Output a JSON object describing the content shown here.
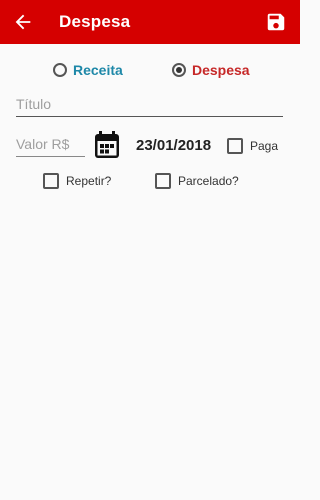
{
  "appbar": {
    "title": "Despesa",
    "back_icon": "arrow-left-icon",
    "save_icon": "floppy-disk-icon",
    "color": "#d50000"
  },
  "type_radio": {
    "options": [
      {
        "label": "Receita",
        "selected": false,
        "color": "#1e88a8"
      },
      {
        "label": "Despesa",
        "selected": true,
        "color": "#c62828"
      }
    ]
  },
  "form": {
    "titulo": {
      "placeholder": "Título",
      "value": ""
    },
    "valor": {
      "placeholder": "Valor R$",
      "value": ""
    },
    "calendar_icon": "calendar-icon",
    "date": "23/01/2018",
    "paga": {
      "label": "Paga",
      "checked": false
    },
    "repetir": {
      "label": "Repetir?",
      "checked": false
    },
    "parcelado": {
      "label": "Parcelado?",
      "checked": false
    }
  }
}
